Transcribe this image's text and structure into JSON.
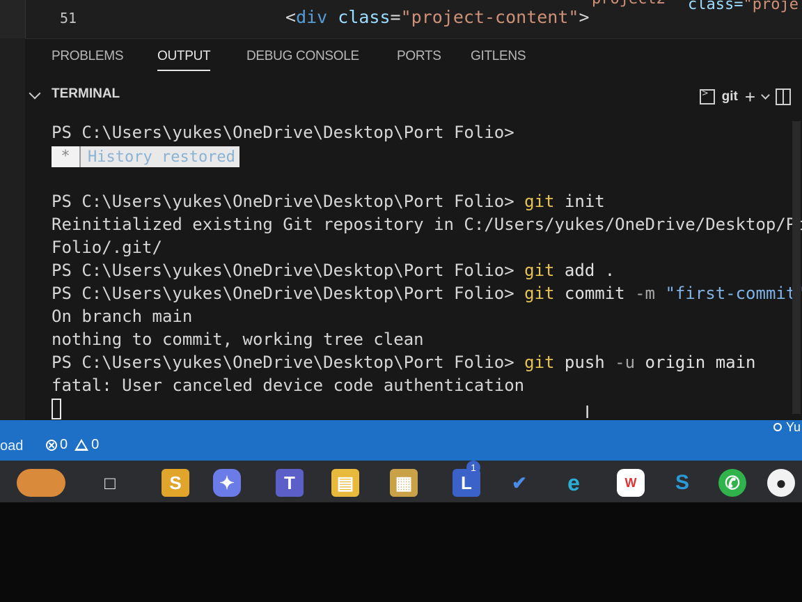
{
  "editor": {
    "line_number": "51",
    "code": {
      "open": "<",
      "tag": "div",
      "attr": " class",
      "eq": "=",
      "value": "\"project-content\"",
      "close": ">"
    },
    "top_right_fragment": "project2",
    "top_right_class": "class=",
    "top_right_value": "\"proje"
  },
  "panel": {
    "tabs": [
      {
        "label": "PROBLEMS",
        "active": false
      },
      {
        "label": "OUTPUT",
        "active": true
      },
      {
        "label": "DEBUG CONSOLE",
        "active": false
      },
      {
        "label": "PORTS",
        "active": false
      },
      {
        "label": "GITLENS",
        "active": false
      }
    ],
    "terminal_section_title": "TERMINAL",
    "terminal_name": "git"
  },
  "terminal": {
    "prompt": "PS C:\\Users\\yukes\\OneDrive\\Desktop\\Port Folio>",
    "history_star": "*",
    "history_label": "History restored",
    "cmd_git": "git",
    "cmd_init": " init",
    "out_reinit_1": "Reinitialized existing Git repository in C:/Users/yukes/OneDrive/Desktop/Port",
    "out_reinit_2": "Folio/.git/",
    "cmd_add": " add .",
    "cmd_commit": " commit",
    "cmd_commit_flag": " -m",
    "cmd_commit_msg": " \"first-commit\"",
    "out_branch": "On branch main",
    "out_nothing": "nothing to commit, working tree clean",
    "cmd_push": " push",
    "cmd_push_flag": " -u",
    "cmd_push_args": " origin main",
    "out_fatal": "fatal: User canceled device code authentication"
  },
  "statusbar": {
    "left_fragment": "oad",
    "errors": "0",
    "warnings": "0",
    "right_fragment": "Yu"
  },
  "taskbar": {
    "badge": "1",
    "icons": [
      "pizza-app-icon",
      "file-explorer-icon",
      "sublime-text-icon",
      "copilot-icon",
      "teams-icon",
      "folder-icon",
      "store-icon",
      "office-lens-icon",
      "todo-icon",
      "edge-icon",
      "wps-office-icon",
      "skype-icon",
      "whatsapp-icon",
      "github-icon"
    ]
  },
  "colors": {
    "statusbar": "#1e6fc6",
    "git_command": "#e5c453",
    "string": "#7fb2e6",
    "panel_bg": "#181818"
  }
}
